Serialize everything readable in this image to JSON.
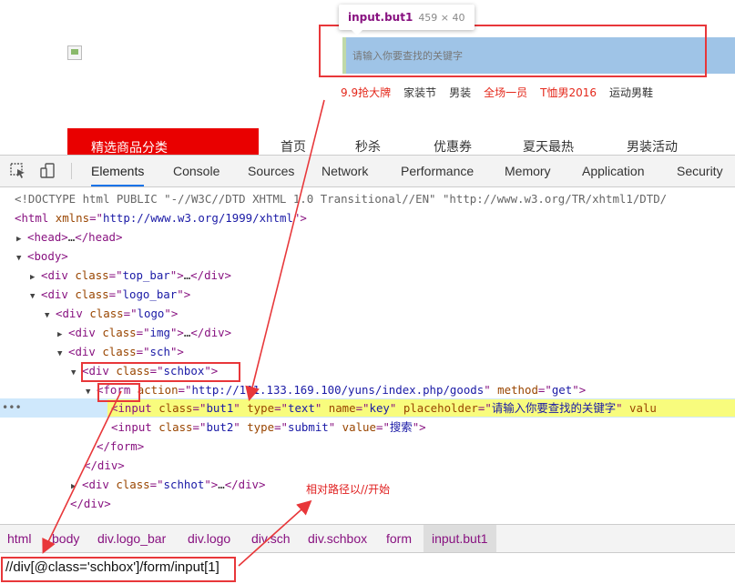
{
  "site": {
    "tooltip": {
      "selector": "input.but1",
      "size": "459 × 40"
    },
    "search_placeholder": "请输入你要查找的关键字",
    "hot_links": [
      {
        "text": "9.9抢大牌",
        "red": true
      },
      {
        "text": "家装节",
        "red": false
      },
      {
        "text": "男装",
        "red": false
      },
      {
        "text": "全场一员",
        "red": true
      },
      {
        "text": "T恤男2016",
        "red": true
      },
      {
        "text": "运动男鞋",
        "red": false
      }
    ],
    "category_banner": "精选商品分类",
    "nav": [
      "首页",
      "秒杀",
      "优惠券",
      "夏天最热",
      "男装活动"
    ]
  },
  "devtools": {
    "tabs": [
      "Elements",
      "Console",
      "Sources",
      "Network",
      "Performance",
      "Memory",
      "Application",
      "Security"
    ],
    "active_tab": "Elements",
    "dom": {
      "doctype": "<!DOCTYPE html PUBLIC \"-//W3C//DTD XHTML 1.0 Transitional//EN\" \"http://www.w3.org/TR/xhtml1/DTD/",
      "html_xmlns": "http://www.w3.org/1999/xhtml",
      "top_bar_class": "top_bar",
      "logo_bar_class": "logo_bar",
      "logo_class": "logo",
      "img_class": "img",
      "sch_class": "sch",
      "schbox_class": "schbox",
      "form_action": "http://101.133.169.100/yuns/index.php/goods",
      "form_method": "get",
      "input1": {
        "class": "but1",
        "type": "text",
        "name": "key",
        "placeholder": "请输入你要查找的关键字",
        "trail": "valu"
      },
      "input2": {
        "class": "but2",
        "type": "submit",
        "value": "搜索"
      },
      "schhot_class": "schhot"
    },
    "breadcrumb": [
      "html",
      "body",
      "div.logo_bar",
      "div.logo",
      "div.sch",
      "div.schbox",
      "form",
      "input.but1"
    ],
    "active_crumb": "input.but1",
    "xpath": "//div[@class='schbox']/form/input[1]"
  },
  "annotation": {
    "label": "相对路径以//开始",
    "color": "#e8373a"
  }
}
